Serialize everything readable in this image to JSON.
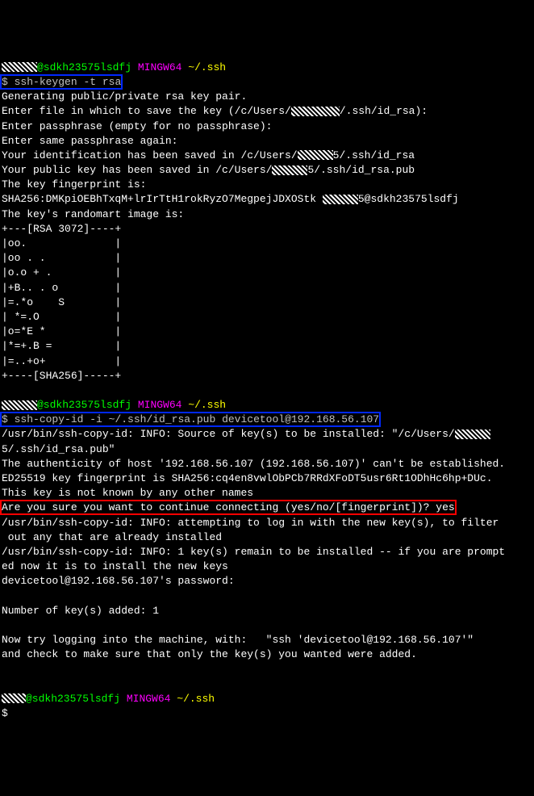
{
  "prompt1": {
    "user_host": "@sdkh23575lsdfj",
    "shell": "MINGW64",
    "path": "~/.ssh",
    "dollar": "$",
    "command": "ssh-keygen -t rsa"
  },
  "keygen": {
    "l1": "Generating public/private rsa key pair.",
    "l2_a": "Enter file in which to save the key (/c/Users/",
    "l2_b": "/.ssh/id_rsa):",
    "l3": "Enter passphrase (empty for no passphrase):",
    "l4": "Enter same passphrase again:",
    "l5_a": "Your identification has been saved in /c/Users/",
    "l5_b": "5/.ssh/id_rsa",
    "l6_a": "Your public key has been saved in /c/Users/",
    "l6_b": "5/.ssh/id_rsa.pub",
    "l7": "The key fingerprint is:",
    "l8_a": "SHA256:DMKpiOEBhTxqM+lrIrTtH1rokRyzO7MegpejJDXOStk ",
    "l8_b": "5@sdkh23575lsdfj",
    "l9": "The key's randomart image is:",
    "art": [
      "+---[RSA 3072]----+",
      "|oo.              |",
      "|oo . .           |",
      "|o.o + .          |",
      "|+B.. . o         |",
      "|=.*o    S        |",
      "| *=.O            |",
      "|o=*E *           |",
      "|*=+.B =          |",
      "|=..+o+           |",
      "+----[SHA256]-----+"
    ]
  },
  "prompt2": {
    "user_host": "@sdkh23575lsdfj",
    "shell": "MINGW64",
    "path": "~/.ssh",
    "dollar": "$",
    "command": "ssh-copy-id -i ~/.ssh/id_rsa.pub devicetool@192.168.56.107"
  },
  "copyid": {
    "l1_a": "/usr/bin/ssh-copy-id: INFO: Source of key(s) to be installed: \"/c/Users/",
    "l1_b": "5/.ssh/id_rsa.pub\"",
    "l2": "The authenticity of host '192.168.56.107 (192.168.56.107)' can't be established.",
    "l3": "ED25519 key fingerprint is SHA256:cq4en8vwlObPCb7RRdXFoDT5usr6Rt1ODhHc6hp+DUc.",
    "l4": "This key is not known by any other names",
    "l5": "Are you sure you want to continue connecting (yes/no/[fingerprint])? yes",
    "l6": "/usr/bin/ssh-copy-id: INFO: attempting to log in with the new key(s), to filter",
    "l7": " out any that are already installed",
    "l8": "/usr/bin/ssh-copy-id: INFO: 1 key(s) remain to be installed -- if you are prompt",
    "l9": "ed now it is to install the new keys",
    "l10": "devicetool@192.168.56.107's password:",
    "l11": "Number of key(s) added: 1",
    "l12": "Now try logging into the machine, with:   \"ssh 'devicetool@192.168.56.107'\"",
    "l13": "and check to make sure that only the key(s) you wanted were added."
  },
  "prompt3": {
    "user_host": "@sdkh23575lsdfj",
    "shell": "MINGW64",
    "path": "~/.ssh",
    "dollar": "$"
  }
}
